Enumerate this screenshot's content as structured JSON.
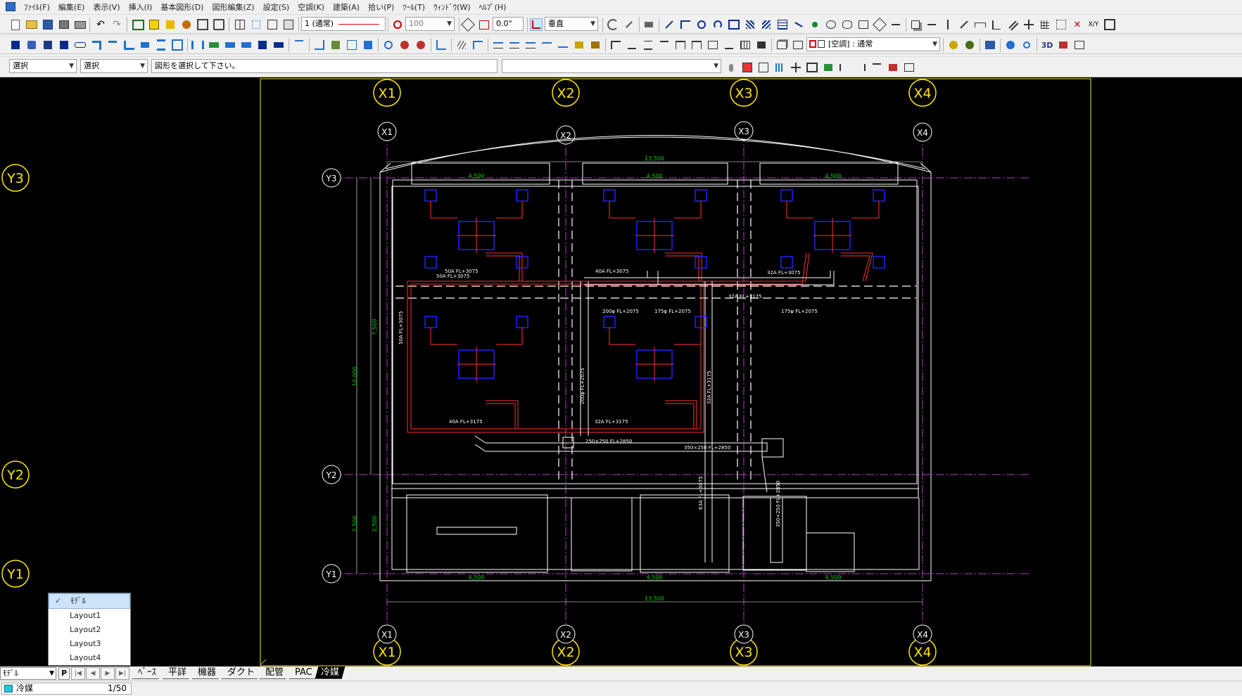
{
  "menu": [
    "ﾌｧｲﾙ(F)",
    "編集(E)",
    "表示(V)",
    "挿入(I)",
    "基本図形(D)",
    "図形編集(Z)",
    "設定(S)",
    "空調(K)",
    "建築(A)",
    "拾い(P)",
    "ﾂｰﾙ(T)",
    "ｳｨﾝﾄﾞｳ(W)",
    "ﾍﾙﾌﾟ(H)"
  ],
  "toolbar1": {
    "pen_combo": "1 (通常)",
    "scale_combo": "100",
    "angle_value": "0.0°",
    "direction_combo": "垂直"
  },
  "toolbar2": {
    "layer_combo": "[空調] : 通常"
  },
  "toolbar3": {
    "mode_combo1": "選択",
    "mode_combo2": "選択",
    "message": "図形を選択して下さい。",
    "input_combo": ""
  },
  "drawing": {
    "grid_x": [
      "X1",
      "X2",
      "X3",
      "X4"
    ],
    "grid_y": [
      "Y1",
      "Y2",
      "Y3"
    ],
    "dims": {
      "overall": "13,500",
      "bay": "4,500",
      "height_total": "10,000",
      "height_upper": "7,500",
      "height_lower": "2,500"
    },
    "pipe_labels": {
      "p50a_top": "50A FL+3075",
      "p40a_top": "40A FL+3075",
      "p50a_top2": "50A FL+3075",
      "p32a_top": "32A FL+3075",
      "p32a_mid": "32A FL+3175",
      "p200": "200φ FL+2075",
      "p175": "175φ FL+2075",
      "p175b": "175φ FL+2075",
      "p50a_vert": "50A FL+3075",
      "p40a_bottom": "40A FL+3175",
      "p32a_bottom": "32A FL+3175",
      "p250": "250×250 FL+2850",
      "p350": "350×250 FL+2850",
      "p200_vert": "200φ FL+2075",
      "p32a_vert": "32A FL+3175",
      "p63a_vert": "63A FL+3075",
      "p350_vert": "350×250 FL+2850"
    }
  },
  "layout_menu": [
    "ﾓﾃﾞﾙ",
    "Layout1",
    "Layout2",
    "Layout3",
    "Layout4"
  ],
  "bottom": {
    "mode": "ﾓﾃﾞﾙ",
    "p_label": "P",
    "tabs": [
      "ﾍﾞｰｽ",
      "平詳",
      "機器",
      "ダクト",
      "配管",
      "PAC",
      "冷媒"
    ]
  },
  "status": {
    "layer": "冷媒",
    "scale": "1/50"
  },
  "colors": {
    "background": "#000000",
    "grid_line": "#b040c0",
    "bubble": "#ffe600",
    "wall": "#ffffff",
    "pipe": "#ff3030",
    "equipment": "#2020ff",
    "dimension": "#00d000"
  }
}
